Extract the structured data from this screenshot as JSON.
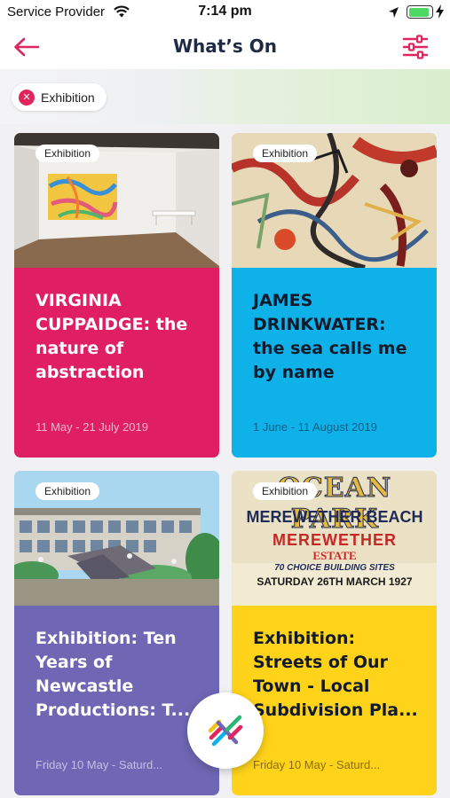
{
  "status_bar": {
    "carrier": "Service Provider",
    "time": "7:14 pm",
    "battery_level": 0.9
  },
  "header": {
    "title": "What’s On"
  },
  "filters": {
    "active": [
      {
        "label": "Exhibition"
      }
    ]
  },
  "colors": {
    "brand_pink": "#e0245e",
    "card_pink": "#e01f62",
    "card_blue": "#0fb1e9",
    "card_purple": "#6f67b4",
    "card_yellow": "#ffd31a",
    "title_navy": "#1f2a44"
  },
  "cards": [
    {
      "badge": "Exhibition",
      "title": "VIRGINIA CUPPAIDGE: the nature of abstraction",
      "date": "11 May - 21 July 2019",
      "color": "#e01f62"
    },
    {
      "badge": "Exhibition",
      "title": "JAMES DRINKWATER: the sea calls me by name",
      "date": "1 June - 11 August 2019",
      "color": "#0fb1e9"
    },
    {
      "badge": "Exhibition",
      "title": "Exhibition: Ten Years of Newcastle Productions: T...",
      "date": "Friday 10 May - Saturd...",
      "color": "#6f67b4"
    },
    {
      "badge": "Exhibition",
      "title": "Exhibition: Streets of Our Town - Local Subdivision Pla...",
      "date": "Friday 10 May - Saturd...",
      "color": "#ffd31a",
      "poster": {
        "line1": "OCEAN PARK",
        "line2": "MEREWETHER BEACH",
        "line3": "MEREWETHER",
        "line4": "ESTATE",
        "line5": "70 CHOICE BUILDING SITES",
        "line6": "SATURDAY 26TH MARCH 1927"
      }
    }
  ],
  "icons": {
    "back": "arrow-left-icon",
    "filter": "sliders-icon",
    "fab": "app-logo-icon"
  }
}
